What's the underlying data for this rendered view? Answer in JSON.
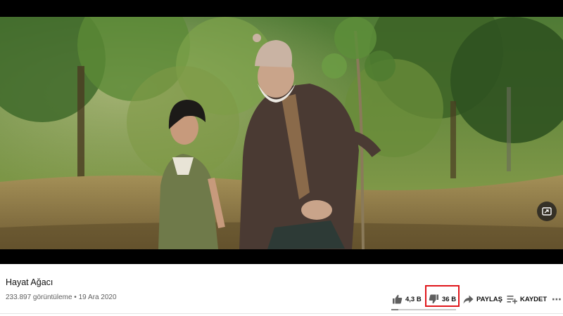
{
  "video": {
    "title": "Hayat Ağacı",
    "views": "233.897 görüntüleme",
    "separator": " • ",
    "date": "19 Ara 2020"
  },
  "actions": {
    "like_label": "4,3 B",
    "dislike_label": "36 B",
    "share_label": "PAYLAŞ",
    "save_label": "KAYDET",
    "more_label": "⋯"
  },
  "sentiment": {
    "like_ratio": 0.11
  },
  "icons": {
    "like": "thumbs-up-icon",
    "dislike": "thumbs-down-icon",
    "share": "share-arrow-icon",
    "save": "playlist-add-icon",
    "more": "more-horizontal-icon",
    "miniplayer": "miniplayer-icon"
  },
  "colors": {
    "highlight": "#e0161b",
    "text_primary": "#0f0f0f",
    "text_secondary": "#606060"
  }
}
